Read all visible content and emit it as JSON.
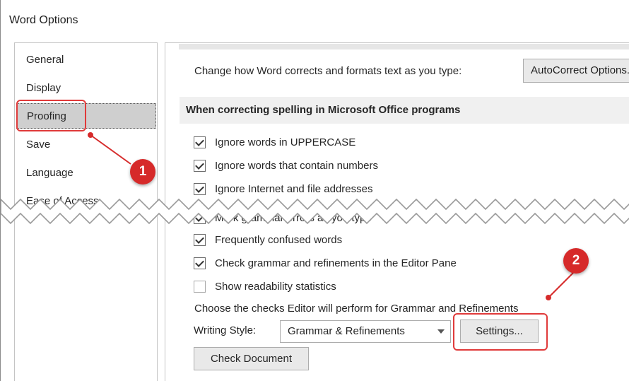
{
  "window": {
    "title": "Word Options"
  },
  "sidebar": {
    "items": [
      {
        "label": "General",
        "selected": false
      },
      {
        "label": "Display",
        "selected": false
      },
      {
        "label": "Proofing",
        "selected": true
      },
      {
        "label": "Save",
        "selected": false
      },
      {
        "label": "Language",
        "selected": false
      },
      {
        "label": "Ease of Access",
        "selected": false
      }
    ]
  },
  "autocorrect": {
    "description": "Change how Word corrects and formats text as you type:",
    "button_label": "AutoCorrect Options..."
  },
  "spelling_section": {
    "header": "When correcting spelling in Microsoft Office programs",
    "options": [
      {
        "label": "Ignore words in UPPERCASE",
        "checked": true
      },
      {
        "label": "Ignore words that contain numbers",
        "checked": true
      },
      {
        "label": "Ignore Internet and file addresses",
        "checked": true
      }
    ]
  },
  "grammar_section": {
    "options": [
      {
        "label": "Mark grammar errors as you type",
        "checked": true
      },
      {
        "label": "Frequently confused words",
        "checked": true
      },
      {
        "label": "Check grammar and refinements in the Editor Pane",
        "checked": true
      },
      {
        "label": "Show readability statistics",
        "checked": false
      }
    ],
    "editor_text": "Choose the checks Editor will perform for Grammar and Refinements",
    "writing_style_label": "Writing Style:",
    "writing_style_value": "Grammar & Refinements",
    "settings_button": "Settings...",
    "check_document_button": "Check Document"
  },
  "annotations": [
    {
      "number": "1"
    },
    {
      "number": "2"
    }
  ],
  "colors": {
    "callout": "#d62a2a",
    "selected_bg": "#cfcfcf",
    "section_bg": "#f0f0f0"
  }
}
